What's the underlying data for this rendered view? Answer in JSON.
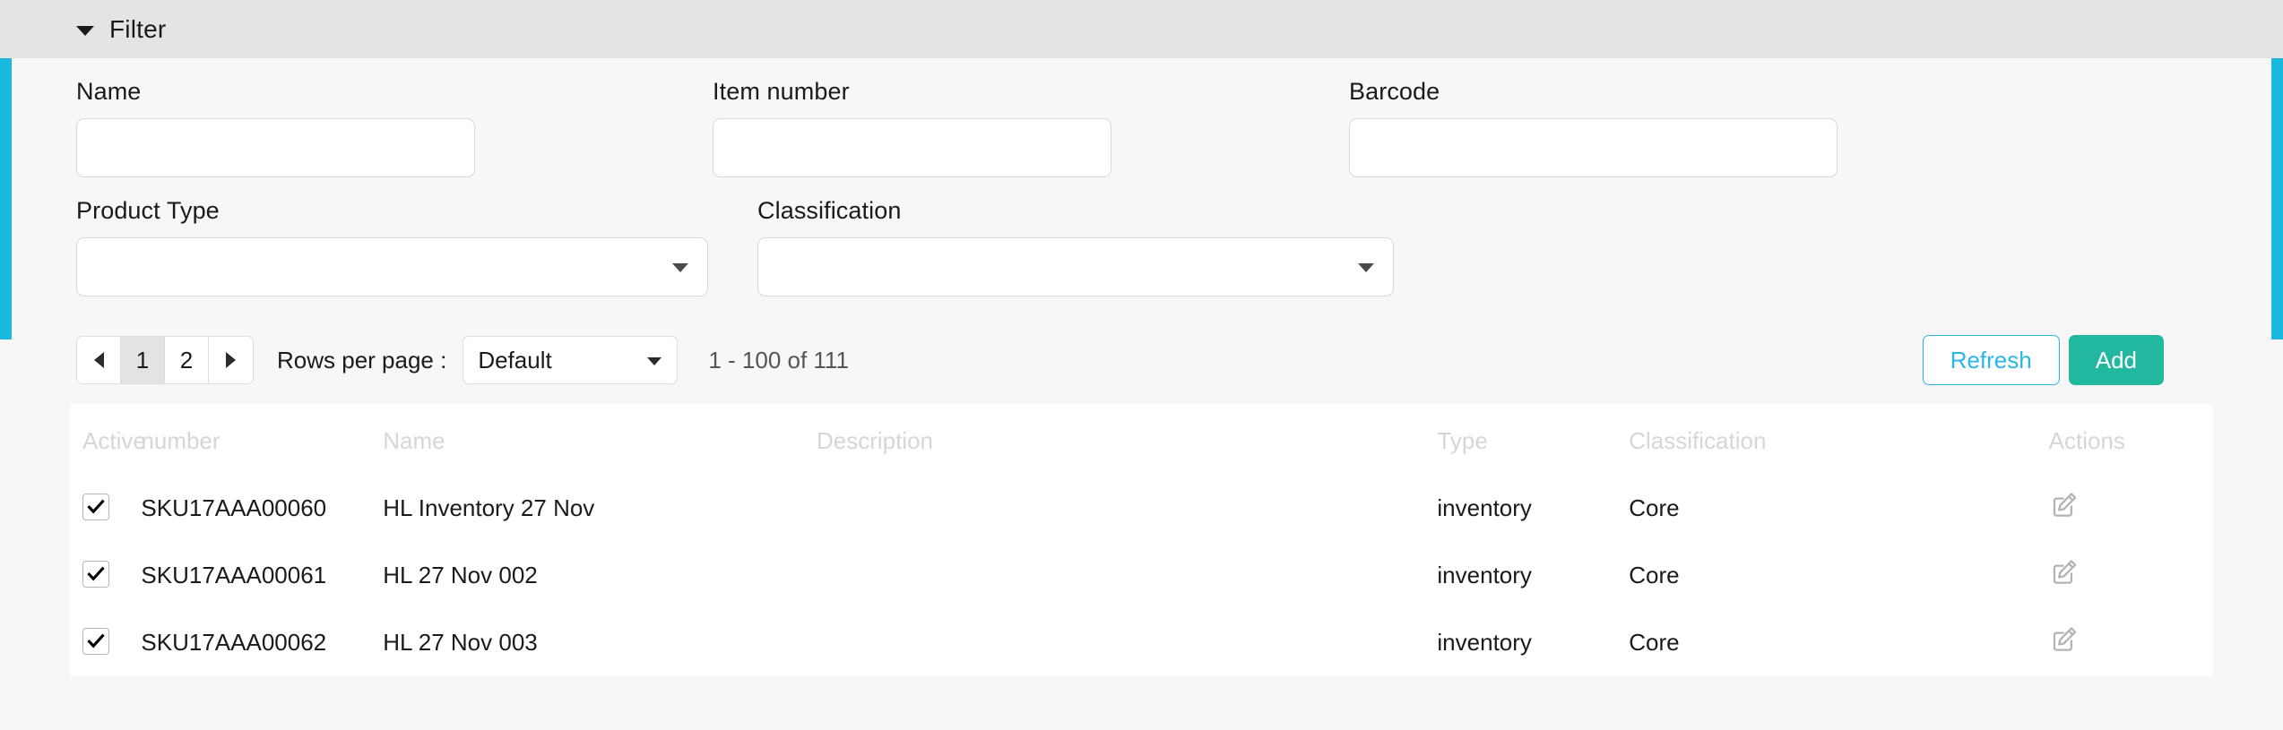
{
  "filter_header": {
    "title": "Filter",
    "caret_icon": "caret-down-icon",
    "expanded": true
  },
  "theme": {
    "rail_color": "#1bb8de",
    "refresh_color": "#2ab6e8",
    "add_color": "#22b8a0",
    "header_bg": "#e4e4e4"
  },
  "filter": {
    "fields": [
      {
        "label": "Name",
        "value": "",
        "placeholder": ""
      },
      {
        "label": "Item number",
        "value": "",
        "placeholder": ""
      },
      {
        "label": "Barcode",
        "value": "",
        "placeholder": ""
      }
    ],
    "selects": [
      {
        "label": "Product Type",
        "value": "",
        "caret_icon": "chevron-down-icon"
      },
      {
        "label": "Classification",
        "value": "",
        "caret_icon": "chevron-down-icon"
      }
    ]
  },
  "toolbar": {
    "prev_icon": "caret-left-icon",
    "next_icon": "caret-right-icon",
    "pages": [
      "1",
      "2"
    ],
    "active_page": "1",
    "rows_per_page_label": "Rows per page :",
    "rows_per_page_value": "Default",
    "range_text": "1 - 100 of 111",
    "refresh_label": "Refresh",
    "add_label": "Add"
  },
  "table": {
    "headers": [
      "Active",
      "number",
      "Name",
      "Description",
      "Type",
      "Classification",
      "Actions"
    ],
    "rows": [
      {
        "active": true,
        "number": "SKU17AAA00060",
        "name": "HL Inventory 27 Nov",
        "description": "",
        "type": "inventory",
        "classification": "Core",
        "action_icon": "edit-icon"
      },
      {
        "active": true,
        "number": "SKU17AAA00061",
        "name": "HL 27 Nov 002",
        "description": "",
        "type": "inventory",
        "classification": "Core",
        "action_icon": "edit-icon"
      },
      {
        "active": true,
        "number": "SKU17AAA00062",
        "name": "HL 27 Nov 003",
        "description": "",
        "type": "inventory",
        "classification": "Core",
        "action_icon": "edit-icon"
      }
    ]
  }
}
